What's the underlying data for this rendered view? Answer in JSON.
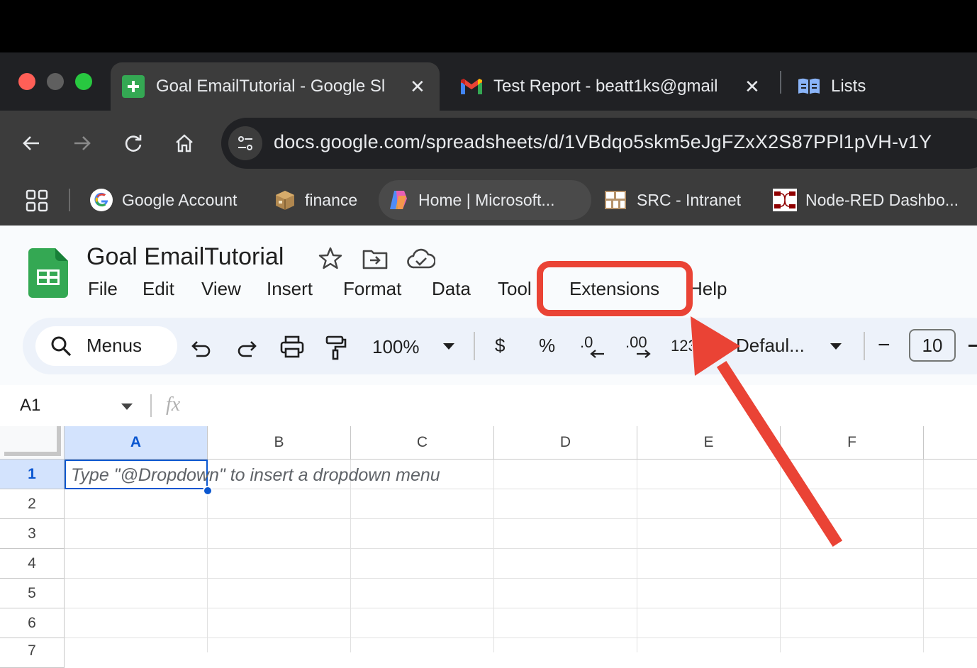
{
  "browser": {
    "tabs": [
      {
        "title": "Goal EmailTutorial - Google Sl",
        "icon": "google-sheets-icon",
        "active": true
      },
      {
        "title": "Test Report - beatt1ks@gmail",
        "icon": "gmail-icon",
        "active": false
      },
      {
        "title": "Lists",
        "icon": "reading-list-icon",
        "active": false
      }
    ],
    "url": "docs.google.com/spreadsheets/d/1VBdqo5skm5eJgFZxX2S87PPl1pVH-v1Y",
    "bookmarks": [
      {
        "label": "Google Account",
        "icon": "google-g-icon"
      },
      {
        "label": "finance",
        "icon": "package-icon"
      },
      {
        "label": "Home | Microsoft...",
        "icon": "copilot-icon"
      },
      {
        "label": "SRC - Intranet",
        "icon": "grid-logo-icon"
      },
      {
        "label": "Node-RED Dashbo...",
        "icon": "node-red-icon"
      }
    ],
    "colors": {
      "titlebar": "#000000",
      "tabstrip": "#202124",
      "toolbar": "#3c3c3c",
      "text": "#e8eaed"
    }
  },
  "sheets": {
    "doc_title": "Goal EmailTutorial",
    "menus": [
      "File",
      "Edit",
      "View",
      "Insert",
      "Format",
      "Data",
      "Tool",
      "Extensions",
      "Help"
    ],
    "toolbar": {
      "search_label": "Menus",
      "zoom": "100%",
      "currency": "$",
      "percent": "%",
      "decrease_decimal": ".0",
      "increase_decimal": ".00",
      "number_format": "123",
      "font": "Defaul...",
      "font_size_minus": "−",
      "font_size": "10"
    },
    "name_box": "A1",
    "fx_label": "fx",
    "columns": [
      "A",
      "B",
      "C",
      "D",
      "E",
      "F"
    ],
    "rows": [
      "1",
      "2",
      "3",
      "4",
      "5",
      "6",
      "7"
    ],
    "cell_a1_placeholder": "Type \"@Dropdown\"  to insert a dropdown menu",
    "colors": {
      "accent": "#0b57d0",
      "selected_header": "#d3e3fd",
      "sheets_green": "#34a853"
    }
  },
  "annotation": {
    "highlight_color": "#ea4335",
    "highlighted_item": "Extensions"
  }
}
